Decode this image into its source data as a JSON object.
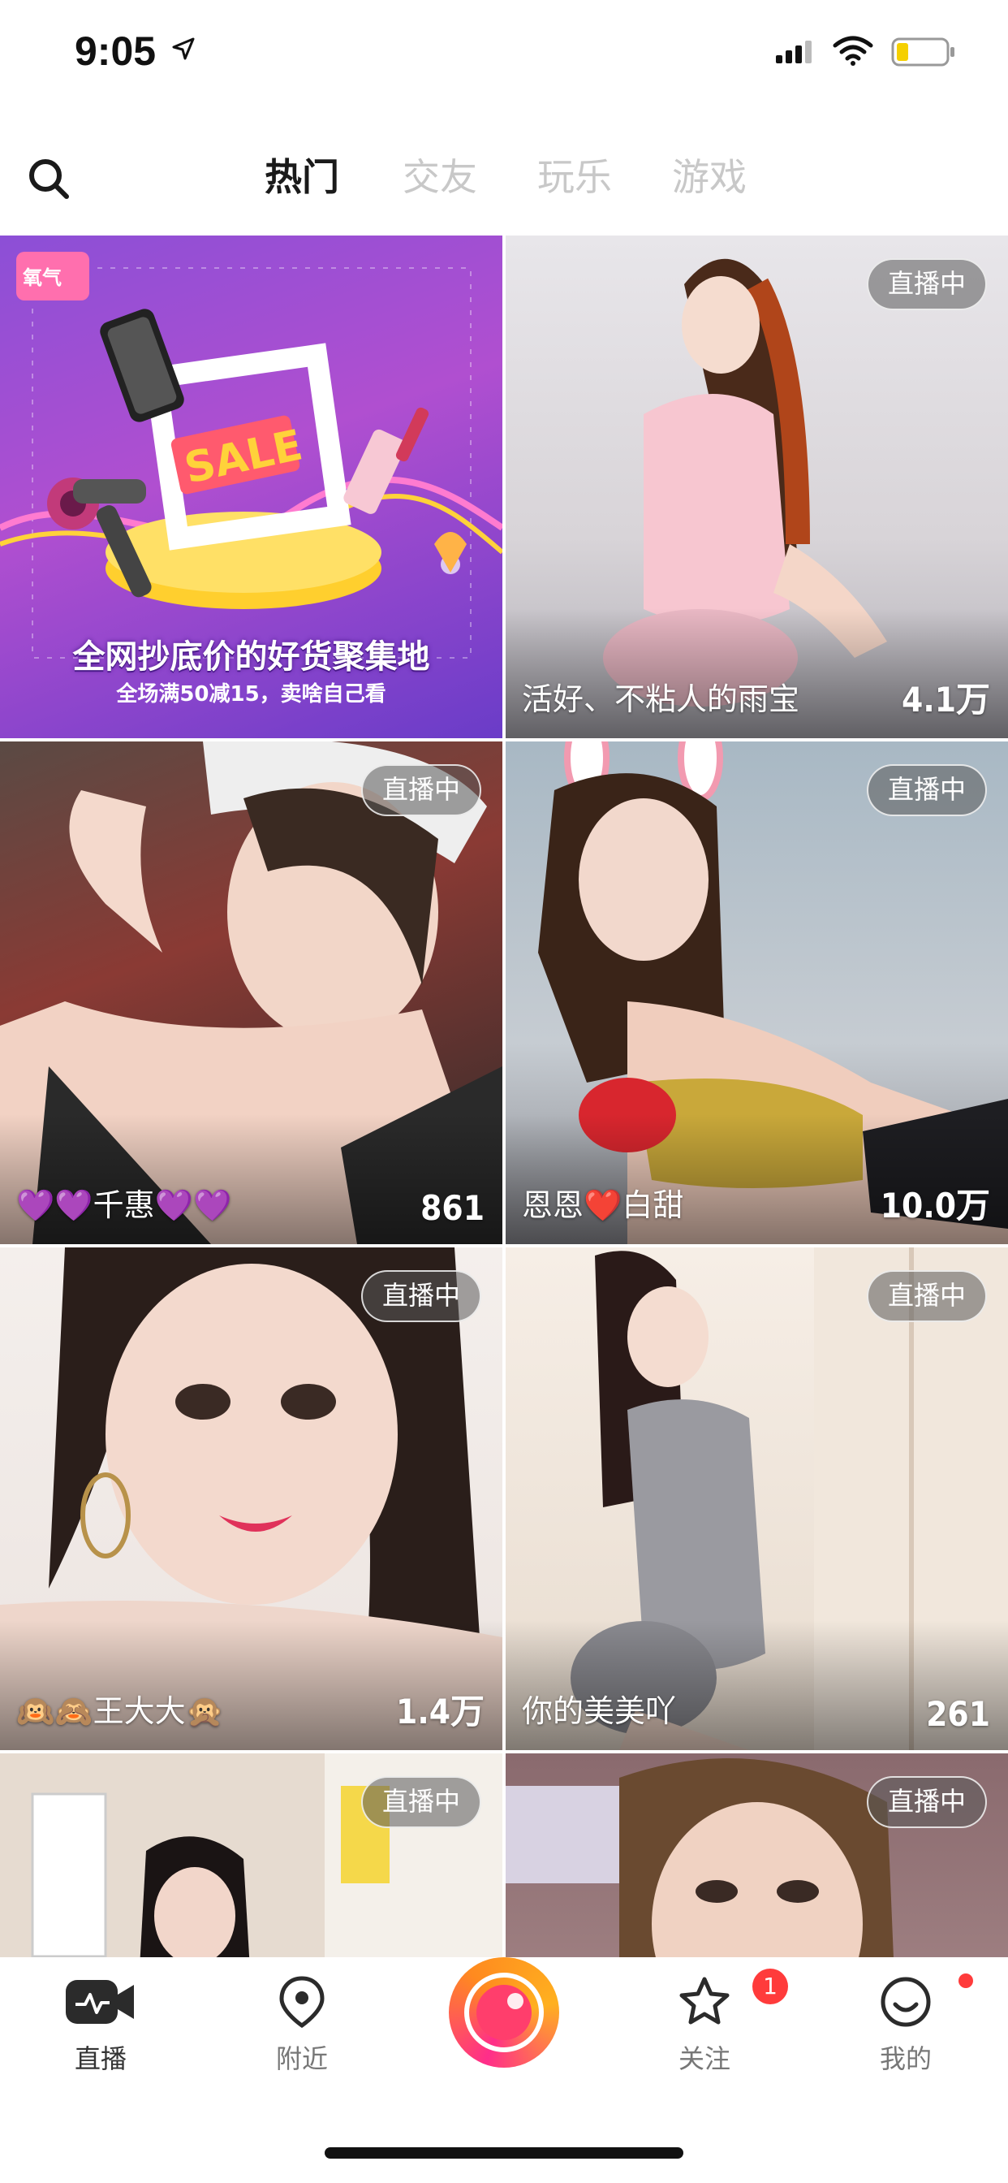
{
  "status_bar": {
    "time": "9:05"
  },
  "top_nav": {
    "tabs": [
      {
        "label": "热门",
        "active": true
      },
      {
        "label": "交友",
        "active": false
      },
      {
        "label": "玩乐",
        "active": false
      },
      {
        "label": "游戏",
        "active": false
      }
    ]
  },
  "ad": {
    "title": "全网抄底价的好货聚集地",
    "subtitle": "全场满50减15，卖啥自己看"
  },
  "live_badge": "直播中",
  "feed": [
    {
      "name": "活好、不粘人的雨宝",
      "count": "4.1万",
      "live": true
    },
    {
      "name": "💜💜千惠💜💜",
      "count": "861",
      "live": true
    },
    {
      "name": "恩恩❤️白甜",
      "count": "10.0万",
      "live": true
    },
    {
      "name": "🙉🙈王大大🙊",
      "count": "1.4万",
      "live": true
    },
    {
      "name": "你的美美吖",
      "count": "261",
      "live": true
    },
    {
      "name": "",
      "count": "",
      "live": true
    },
    {
      "name": "",
      "count": "",
      "live": true
    }
  ],
  "bottom_tabs": [
    {
      "label": "直播",
      "icon": "live-camera-icon"
    },
    {
      "label": "附近",
      "icon": "location-pin-icon"
    },
    {
      "label": "",
      "icon": "record-button"
    },
    {
      "label": "关注",
      "icon": "star-icon",
      "badge": "1"
    },
    {
      "label": "我的",
      "icon": "smiley-icon"
    }
  ],
  "colors": {
    "accent_pink": "#ff2d8a",
    "accent_orange": "#ffb01f",
    "badge_red": "#ff3b3b",
    "ad_purple": "#8c4fd6"
  }
}
